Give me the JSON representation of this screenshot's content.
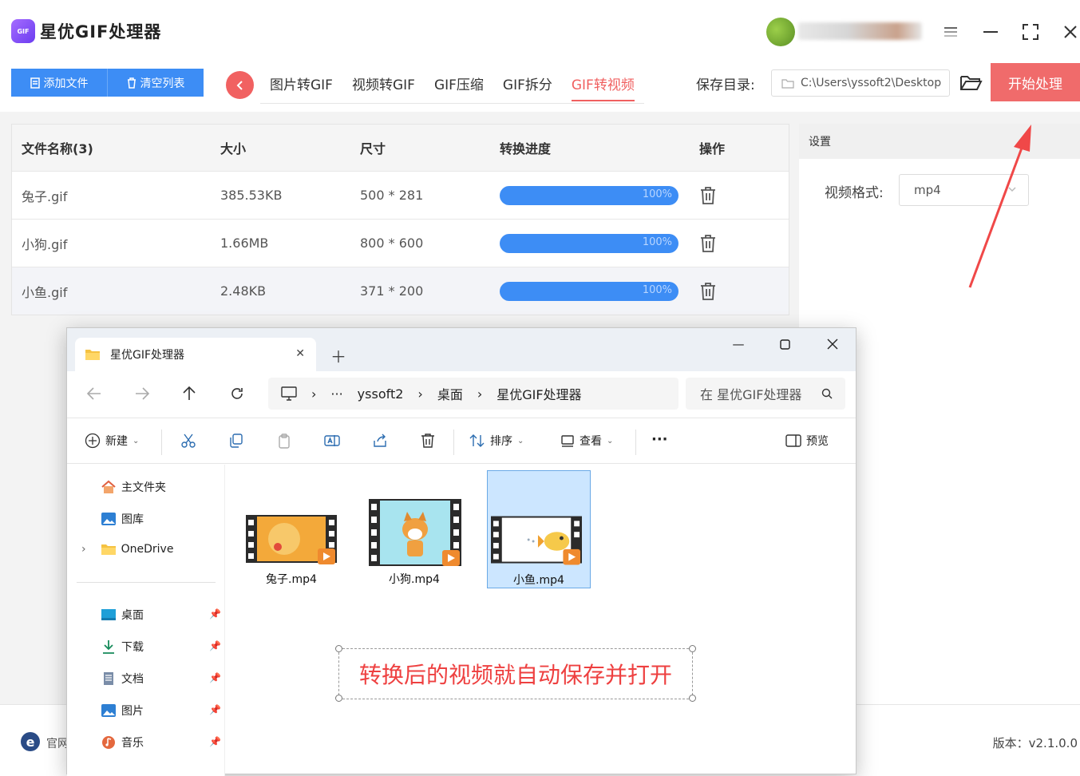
{
  "app": {
    "logo_text": "GIF",
    "title": "星优GIF处理器"
  },
  "toolbar": {
    "add_file": "添加文件",
    "clear_list": "清空列表",
    "tabs": [
      "图片转GIF",
      "视频转GIF",
      "GIF压缩",
      "GIF拆分",
      "GIF转视频"
    ],
    "active_tab": "GIF转视频",
    "save_dir_label": "保存目录:",
    "save_dir_value": "C:\\Users\\yssoft2\\Desktop",
    "start_button": "开始处理"
  },
  "table": {
    "headers": [
      "文件名称(3)",
      "大小",
      "尺寸",
      "转换进度",
      "操作"
    ],
    "rows": [
      {
        "name": "兔子.gif",
        "size": "385.53KB",
        "dim": "500 * 281",
        "progress": "100%"
      },
      {
        "name": "小狗.gif",
        "size": "1.66MB",
        "dim": "800 * 600",
        "progress": "100%"
      },
      {
        "name": "小鱼.gif",
        "size": "2.48KB",
        "dim": "371 * 200",
        "progress": "100%"
      }
    ]
  },
  "settings": {
    "header": "设置",
    "format_label": "视频格式:",
    "format_value": "mp4"
  },
  "footer": {
    "site_label": "官网",
    "version": "版本：v2.1.0.0"
  },
  "explorer": {
    "tab_title": "星优GIF处理器",
    "breadcrumbs": [
      "yssoft2",
      "桌面",
      "星优GIF处理器"
    ],
    "ellipsis": "···",
    "search_placeholder": "在 星优GIF处理器",
    "commands": {
      "new": "新建",
      "sort": "排序",
      "view": "查看",
      "more": "···",
      "preview": "预览"
    },
    "sidebar": {
      "home": "主文件夹",
      "gallery": "图库",
      "onedrive": "OneDrive",
      "desktop": "桌面",
      "downloads": "下载",
      "documents": "文档",
      "pictures": "图片",
      "music": "音乐"
    },
    "files": [
      "兔子.mp4",
      "小狗.mp4",
      "小鱼.mp4"
    ]
  },
  "annotation": "转换后的视频就自动保存并打开",
  "colors": {
    "accent_blue": "#3d8df5",
    "accent_red": "#f06b6b",
    "annotation_red": "#ee4040"
  }
}
